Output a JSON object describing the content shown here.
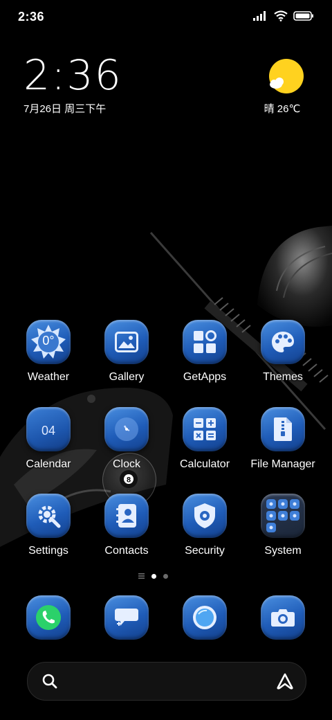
{
  "status_bar": {
    "time": "2:36"
  },
  "clock_widget": {
    "time": "2:36",
    "date": "7月26日 周三下午"
  },
  "weather_widget": {
    "text": "晴 26℃"
  },
  "apps": {
    "weather": {
      "label": "Weather",
      "icon": "weather-icon",
      "tile_text": "0°"
    },
    "gallery": {
      "label": "Gallery",
      "icon": "gallery-icon"
    },
    "getapps": {
      "label": "GetApps",
      "icon": "getapps-icon"
    },
    "themes": {
      "label": "Themes",
      "icon": "themes-icon"
    },
    "calendar": {
      "label": "Calendar",
      "icon": "calendar-icon",
      "tile_text": "04"
    },
    "clock": {
      "label": "Clock",
      "icon": "clock-icon"
    },
    "calculator": {
      "label": "Calculator",
      "icon": "calculator-icon"
    },
    "file_manager": {
      "label": "File Manager",
      "icon": "file-manager-icon"
    },
    "settings": {
      "label": "Settings",
      "icon": "settings-icon"
    },
    "contacts": {
      "label": "Contacts",
      "icon": "contacts-icon"
    },
    "security": {
      "label": "Security",
      "icon": "security-icon"
    },
    "system": {
      "label": "System",
      "icon": "folder-icon"
    }
  },
  "dock": [
    "phone-icon",
    "messages-icon",
    "browser-icon",
    "camera-icon"
  ],
  "page_indicator": {
    "pages": 2,
    "active": 1
  },
  "search_bar": {
    "icons": [
      "search-icon",
      "assistant-icon"
    ]
  },
  "colors": {
    "tile_light": "#4a8fe0",
    "tile_dark": "#13408c",
    "sun": "#ffd21f"
  }
}
